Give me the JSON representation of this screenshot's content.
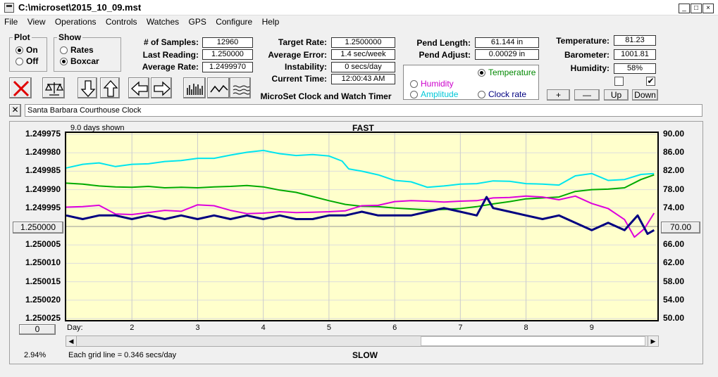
{
  "window": {
    "title": "C:\\microset\\2015_10_09.mst",
    "minimize": "_",
    "maximize": "□",
    "close": "×"
  },
  "menu": [
    "File",
    "View",
    "Operations",
    "Controls",
    "Watches",
    "GPS",
    "Configure",
    "Help"
  ],
  "plot_group": {
    "legend": "Plot",
    "on": "On",
    "off": "Off",
    "selected": "On"
  },
  "show_group": {
    "legend": "Show",
    "rates": "Rates",
    "boxcar": "Boxcar",
    "selected": "Boxcar"
  },
  "stats": {
    "samples_label": "# of Samples:",
    "samples": "12960",
    "last_reading_label": "Last Reading:",
    "last_reading": "1.250000",
    "average_rate_label": "Average Rate:",
    "average_rate": "1.2499970",
    "target_rate_label": "Target Rate:",
    "target_rate": "1.2500000",
    "average_error_label": "Average Error:",
    "average_error": "1.4 sec/week",
    "instability_label": "Instability:",
    "instability": "0 secs/day",
    "current_time_label": "Current Time:",
    "current_time": "12:00:43 AM",
    "pend_length_label": "Pend Length:",
    "pend_length": "61.144 in",
    "pend_adjust_label": "Pend Adjust:",
    "pend_adjust": "0.00029 in",
    "temperature_label": "Temperature:",
    "temperature": "81.23",
    "barometer_label": "Barometer:",
    "barometer": "1001.81",
    "humidity_label": "Humidity:",
    "humidity": "58%"
  },
  "app_caption": "MicroSet Clock and Watch Timer",
  "sensor_select": {
    "temperature": "Temperature",
    "humidity": "Humidity",
    "amplitude": "Amplitude",
    "clock_rate": "Clock rate",
    "selected": "Temperature"
  },
  "scale_buttons": {
    "plus": "+",
    "minus": "—",
    "up": "Up",
    "down": "Down"
  },
  "checkboxes": {
    "left_checked": false,
    "right_checked": true
  },
  "description": {
    "close": "✕",
    "value": "Santa Barbara Courthouse Clock"
  },
  "chart": {
    "days_shown": "9.0 days shown",
    "fast_label": "FAST",
    "slow_label": "SLOW",
    "center_left": "1.250000",
    "center_right": "70.00",
    "bottom_left_btn": "0",
    "day_label": "Day:",
    "grid_note": "Each grid line = 0.346 secs/day",
    "percent": "2.94%"
  },
  "chart_data": {
    "type": "line",
    "xlabel": "Day:",
    "x_ticks": [
      "2",
      "3",
      "4",
      "5",
      "6",
      "7",
      "8",
      "9"
    ],
    "xlim": [
      1,
      10
    ],
    "y_left_ticks": [
      "1.249975",
      "1.249980",
      "1.249985",
      "1.249990",
      "1.249995",
      "1.250000",
      "1.250005",
      "1.250010",
      "1.250015",
      "1.250020",
      "1.250025"
    ],
    "ylim_left": [
      1.250025,
      1.249975
    ],
    "y_right_ticks": [
      "90.00",
      "86.00",
      "82.00",
      "78.00",
      "74.00",
      "70.00",
      "66.00",
      "62.00",
      "58.00",
      "54.00",
      "50.00"
    ],
    "ylim_right": [
      50,
      90
    ],
    "series": [
      {
        "color": "#00e5ee",
        "axis": "right",
        "values": [
          [
            1.0,
            82.7
          ],
          [
            1.25,
            83.5
          ],
          [
            1.5,
            83.8
          ],
          [
            1.75,
            83.0
          ],
          [
            2.0,
            83.5
          ],
          [
            2.25,
            83.6
          ],
          [
            2.5,
            84.1
          ],
          [
            2.75,
            84.3
          ],
          [
            3.0,
            84.8
          ],
          [
            3.25,
            84.8
          ],
          [
            3.5,
            85.5
          ],
          [
            3.75,
            86.1
          ],
          [
            4.0,
            86.5
          ],
          [
            4.25,
            85.8
          ],
          [
            4.5,
            85.4
          ],
          [
            4.75,
            85.6
          ],
          [
            5.0,
            85.3
          ],
          [
            5.2,
            84.2
          ],
          [
            5.3,
            82.5
          ],
          [
            5.5,
            82.0
          ],
          [
            5.75,
            81.2
          ],
          [
            6.0,
            80.0
          ],
          [
            6.25,
            79.7
          ],
          [
            6.5,
            78.5
          ],
          [
            6.75,
            78.8
          ],
          [
            7.0,
            79.2
          ],
          [
            7.25,
            79.3
          ],
          [
            7.5,
            79.9
          ],
          [
            7.75,
            79.8
          ],
          [
            8.0,
            79.3
          ],
          [
            8.25,
            79.2
          ],
          [
            8.5,
            79.0
          ],
          [
            8.75,
            81.0
          ],
          [
            9.0,
            81.5
          ],
          [
            9.25,
            80.0
          ],
          [
            9.5,
            80.2
          ],
          [
            9.75,
            81.3
          ],
          [
            9.95,
            81.5
          ]
        ]
      },
      {
        "color": "#00aa00",
        "axis": "right",
        "values": [
          [
            1.0,
            79.4
          ],
          [
            1.25,
            79.2
          ],
          [
            1.5,
            78.8
          ],
          [
            1.75,
            78.6
          ],
          [
            2.0,
            78.5
          ],
          [
            2.25,
            78.7
          ],
          [
            2.5,
            78.4
          ],
          [
            2.75,
            78.5
          ],
          [
            3.0,
            78.4
          ],
          [
            3.25,
            78.6
          ],
          [
            3.5,
            78.7
          ],
          [
            3.75,
            78.9
          ],
          [
            4.0,
            78.6
          ],
          [
            4.25,
            77.9
          ],
          [
            4.5,
            77.4
          ],
          [
            4.75,
            76.5
          ],
          [
            5.0,
            75.6
          ],
          [
            5.25,
            74.8
          ],
          [
            5.5,
            74.4
          ],
          [
            5.75,
            74.3
          ],
          [
            6.0,
            74.0
          ],
          [
            6.25,
            73.8
          ],
          [
            6.5,
            73.6
          ],
          [
            6.75,
            73.7
          ],
          [
            7.0,
            73.9
          ],
          [
            7.25,
            74.3
          ],
          [
            7.5,
            74.9
          ],
          [
            7.75,
            75.4
          ],
          [
            8.0,
            76.0
          ],
          [
            8.25,
            76.2
          ],
          [
            8.5,
            76.4
          ],
          [
            8.75,
            77.6
          ],
          [
            9.0,
            78.0
          ],
          [
            9.25,
            78.1
          ],
          [
            9.5,
            78.4
          ],
          [
            9.75,
            80.2
          ],
          [
            9.95,
            81.2
          ]
        ]
      },
      {
        "color": "#dd00dd",
        "axis": "right",
        "values": [
          [
            1.0,
            74.2
          ],
          [
            1.25,
            74.3
          ],
          [
            1.5,
            74.6
          ],
          [
            1.75,
            72.7
          ],
          [
            2.0,
            72.6
          ],
          [
            2.25,
            73.0
          ],
          [
            2.5,
            73.5
          ],
          [
            2.75,
            73.3
          ],
          [
            3.0,
            74.7
          ],
          [
            3.25,
            74.5
          ],
          [
            3.5,
            73.5
          ],
          [
            3.75,
            72.8
          ],
          [
            4.0,
            72.9
          ],
          [
            4.25,
            73.2
          ],
          [
            4.5,
            73.0
          ],
          [
            4.75,
            73.1
          ],
          [
            5.0,
            73.2
          ],
          [
            5.25,
            73.4
          ],
          [
            5.5,
            74.5
          ],
          [
            5.75,
            74.6
          ],
          [
            6.0,
            75.4
          ],
          [
            6.25,
            75.6
          ],
          [
            6.5,
            75.5
          ],
          [
            6.75,
            75.3
          ],
          [
            7.0,
            75.5
          ],
          [
            7.25,
            75.6
          ],
          [
            7.5,
            76.2
          ],
          [
            7.75,
            76.3
          ],
          [
            8.0,
            76.6
          ],
          [
            8.25,
            76.4
          ],
          [
            8.5,
            75.8
          ],
          [
            8.75,
            76.6
          ],
          [
            9.0,
            75.0
          ],
          [
            9.25,
            73.9
          ],
          [
            9.5,
            71.5
          ],
          [
            9.65,
            67.7
          ],
          [
            9.8,
            69.5
          ],
          [
            9.95,
            72.9
          ]
        ]
      },
      {
        "color": "#000080",
        "axis": "left",
        "values": [
          [
            1.0,
            1.249997
          ],
          [
            1.25,
            1.249998
          ],
          [
            1.5,
            1.249997
          ],
          [
            1.75,
            1.249997
          ],
          [
            2.0,
            1.249998
          ],
          [
            2.25,
            1.249997
          ],
          [
            2.5,
            1.249998
          ],
          [
            2.75,
            1.249997
          ],
          [
            3.0,
            1.249998
          ],
          [
            3.25,
            1.249997
          ],
          [
            3.5,
            1.249998
          ],
          [
            3.75,
            1.249997
          ],
          [
            4.0,
            1.249998
          ],
          [
            4.25,
            1.249997
          ],
          [
            4.5,
            1.249998
          ],
          [
            4.75,
            1.249998
          ],
          [
            5.0,
            1.249997
          ],
          [
            5.25,
            1.249997
          ],
          [
            5.5,
            1.249996
          ],
          [
            5.75,
            1.249997
          ],
          [
            6.0,
            1.249997
          ],
          [
            6.25,
            1.249997
          ],
          [
            6.5,
            1.249996
          ],
          [
            6.75,
            1.249995
          ],
          [
            7.0,
            1.249996
          ],
          [
            7.25,
            1.249997
          ],
          [
            7.4,
            1.249992
          ],
          [
            7.5,
            1.249995
          ],
          [
            7.75,
            1.249996
          ],
          [
            8.0,
            1.249997
          ],
          [
            8.25,
            1.249998
          ],
          [
            8.5,
            1.249997
          ],
          [
            8.75,
            1.249999
          ],
          [
            9.0,
            1.250001
          ],
          [
            9.25,
            1.249999
          ],
          [
            9.5,
            1.250001
          ],
          [
            9.7,
            1.249997
          ],
          [
            9.85,
            1.250002
          ],
          [
            9.95,
            1.250001
          ]
        ]
      }
    ]
  }
}
